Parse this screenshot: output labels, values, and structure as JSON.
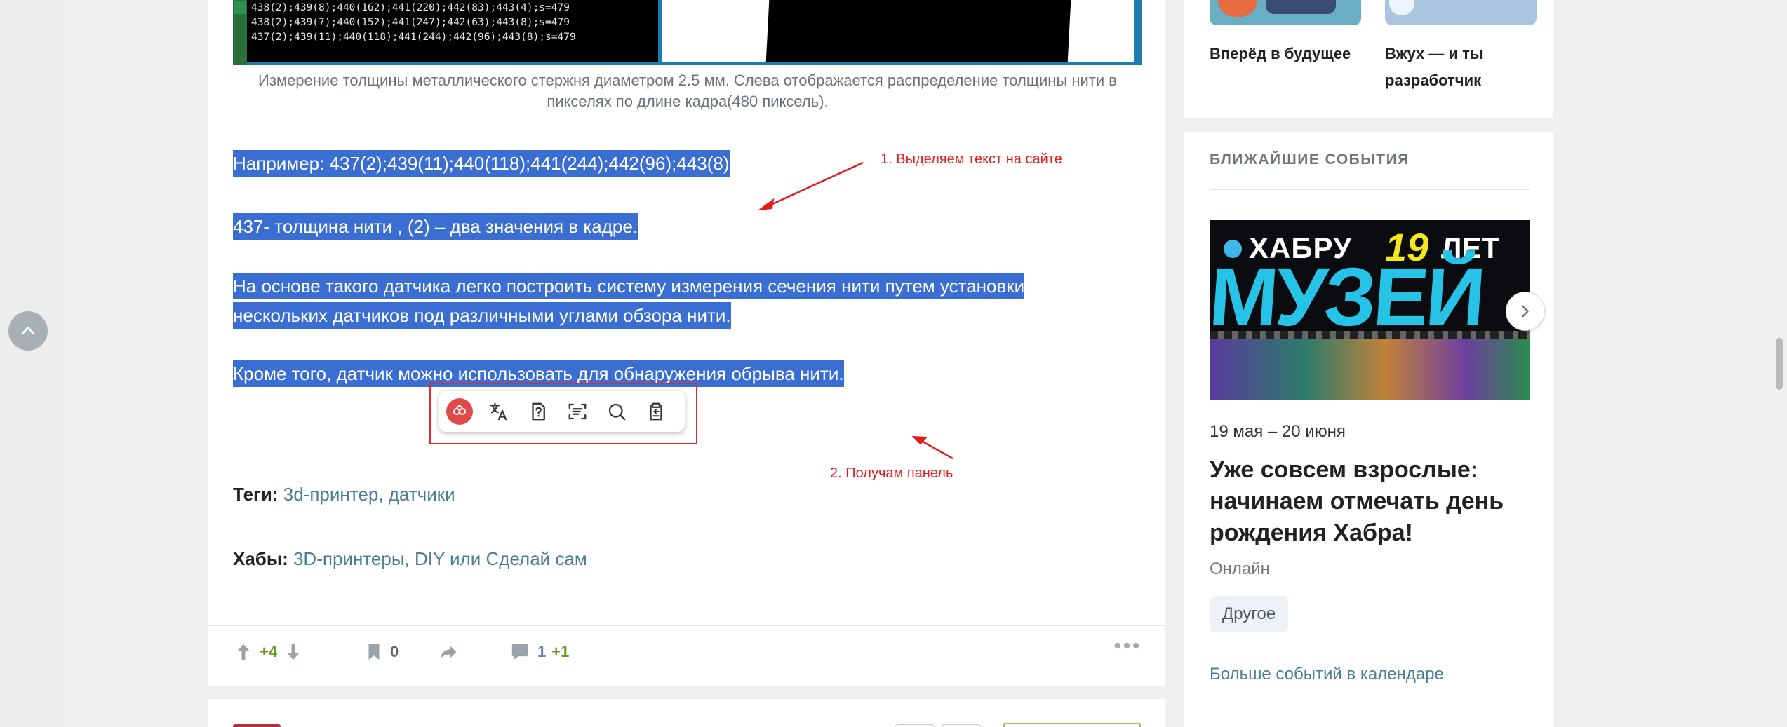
{
  "console_lines": [
    "438(2);439(8);440(162);441(220);442(83);443(4);s=479",
    "438(2);439(7);440(152);441(247);442(63);443(8);s=479",
    "437(2);439(11);440(118);441(244);442(96);443(8);s=479"
  ],
  "caption": "Измерение толщины металлического стержня диаметром 2.5 мм. Слева отображается распределение толщины нити в пикселях по длине кадра(480 пиксель).",
  "paragraphs": {
    "p1": "Например: 437(2);439(11);440(118);441(244);442(96);443(8)",
    "p2": "437- толщина нити , (2) – два значения в кадре.",
    "p3_line1": "На основе такого датчика легко построить систему измерения сечения нити путем установки",
    "p3_line2": "нескольких датчиков под различными углами обзора нити.",
    "p4": "Кроме того, датчик можно использовать для обнаружения обрыва нити."
  },
  "annotations": {
    "a1": "1. Выделяем текст на сайте",
    "a2": "2. Получам панель"
  },
  "toolbar_icons": [
    "app-logo-icon",
    "translate-icon",
    "explain-icon",
    "summarize-icon",
    "search-icon",
    "copy-icon"
  ],
  "tags": {
    "label": "Теги:",
    "value": "3d-принтер, датчики"
  },
  "hubs": {
    "label": "Хабы:",
    "value": "3D-принтеры, DIY или Сделай сам"
  },
  "footer": {
    "votes": "+4",
    "bookmarks": "0",
    "comments": "1",
    "comments_new": "+1",
    "score_color": "#6a9a1f"
  },
  "sidebar": {
    "card1_title": "Вперёд в будущее",
    "card2_title_line1": "Вжух — и ты",
    "card2_title_line2": "разработчик"
  },
  "events": {
    "heading": "БЛИЖАЙШИЕ СОБЫТИЯ",
    "banner_text1": "ХАБРУ",
    "banner_number": "19",
    "banner_text2": "ЛЕТ",
    "banner_big": "МУЗЕЙ",
    "date": "19 мая – 20 июня",
    "title": "Уже совсем взрослые: начинаем отмечать день рождения Хабра!",
    "place": "Онлайн",
    "tag": "Другое",
    "more_link": "Больше событий в календаре"
  },
  "colors": {
    "selection": "#3b6ed3",
    "link": "#4a7d98",
    "annotation": "#e21c1c"
  }
}
